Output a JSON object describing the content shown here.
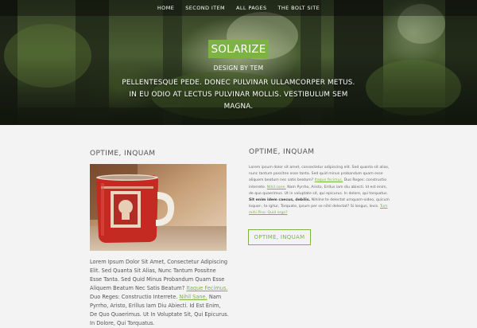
{
  "nav": {
    "items": [
      "HOME",
      "SECOND ITEM",
      "ALL PAGES",
      "THE BOLT SITE"
    ]
  },
  "hero": {
    "site_title": "SOLARIZE",
    "tagline": "DESIGN BY TEM",
    "intro": "PELLENTESQUE PEDE. DONEC PULVINAR ULLAMCORPER METUS. IN EU ODIO AT LECTUS PULVINAR MOLLIS. VESTIBULUM SEM MAGNA."
  },
  "left": {
    "heading": "OPTIME, INQUAM",
    "image_alt": "mug-photo",
    "text": {
      "p1": "Lorem Ipsum Dolor Sit Amet, Consectetur Adipiscing Elit. Sed Quanta Sit Alias, Nunc Tantum Possitne Esse Tanta. Sed Quid Minus Probandum Quam Esse Aliquem Beatum Nec Satis Beatum? ",
      "link1": "Itaque Fecimus.",
      "p2": " Duo Reges: Constructio Interrete. ",
      "link2": "Nihil Sane.",
      "p3": " Nam Pyrrho, Aristo, Erillus Iam Diu Abiecti. Id Est Enim, De Quo Quaerimus. Ut In Voluptate Sit, Qui Epicurus. In Dolore, Qui Torquatus."
    }
  },
  "right": {
    "heading": "OPTIME, INQUAM",
    "text": {
      "p1": "Lorem ipsum dolor sit amet, consectetur adipiscing elit. Sed quanta sit alias, nunc tantum possitne esse tanta. Sed quid minus probandum quam esse aliquem beatum nec satis beatum? ",
      "link1": "Itaque fecimus.",
      "p2": " Duo Reges: constructio interrete. ",
      "link2": "Nihil sane.",
      "p3": " Nam Pyrrho, Aristo, Erillus iam diu abiecti. Id est enim, de quo quaerimus. Ut in voluptate sit, qui epicurus. In dolore, qui torquatus. ",
      "bold": "Sit enim idem caecus, debilis.",
      "p4": " Nihilne te delectat umquam-video, quicum loquar-, te igitur, Torquate, ipsum per se nihil delectat? Si longus, levis. ",
      "link3": "Tum mihi Piso: Quid ergo?"
    },
    "button_label": "OPTIME, INQUAM"
  },
  "colors": {
    "accent": "#7cb342",
    "background": "#f3f3f3",
    "text": "#555555"
  }
}
